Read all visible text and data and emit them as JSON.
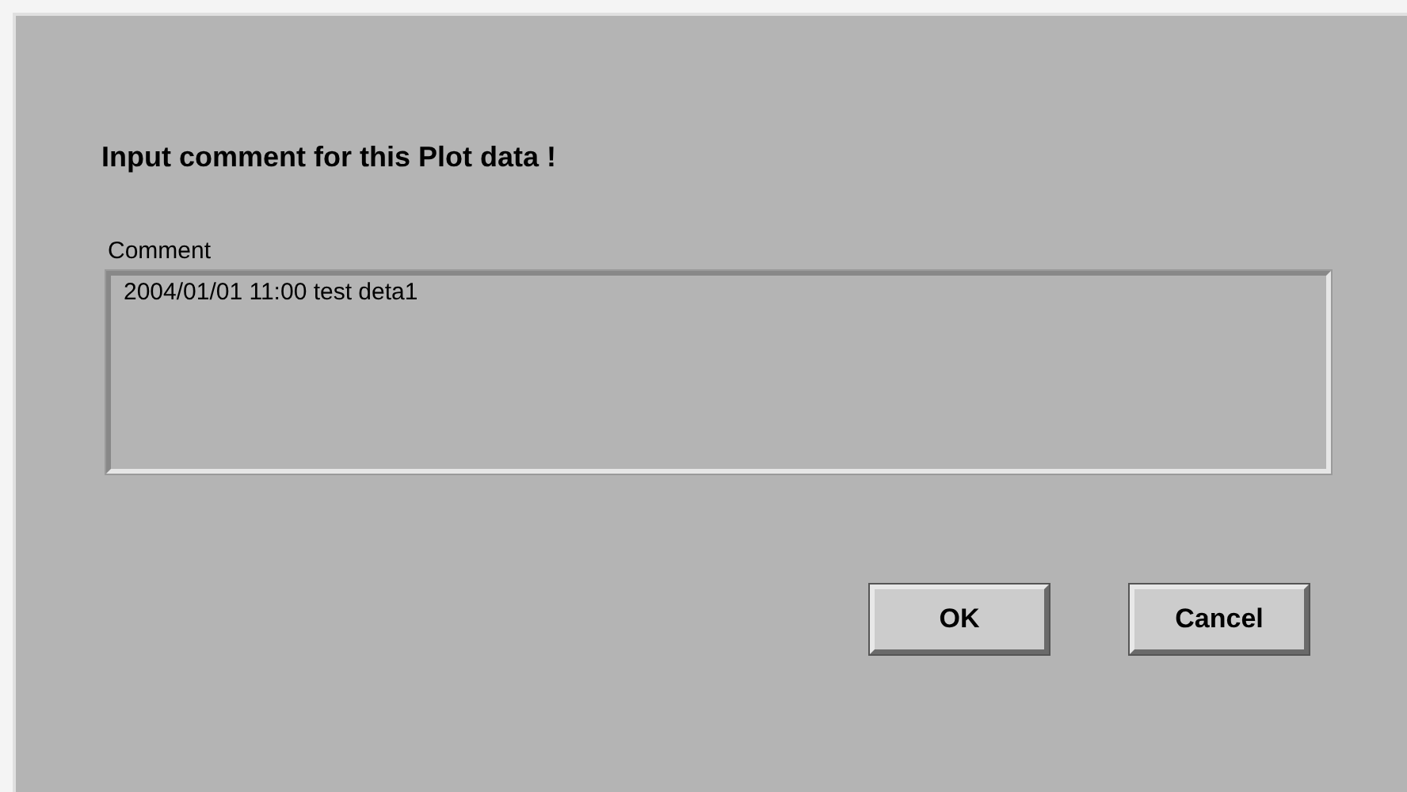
{
  "dialog": {
    "title": "Input comment for this Plot data !",
    "field": {
      "label": "Comment",
      "value": "2004/01/01 11:00 test deta1"
    },
    "buttons": [
      {
        "label": "OK"
      },
      {
        "label": "Cancel"
      }
    ]
  }
}
